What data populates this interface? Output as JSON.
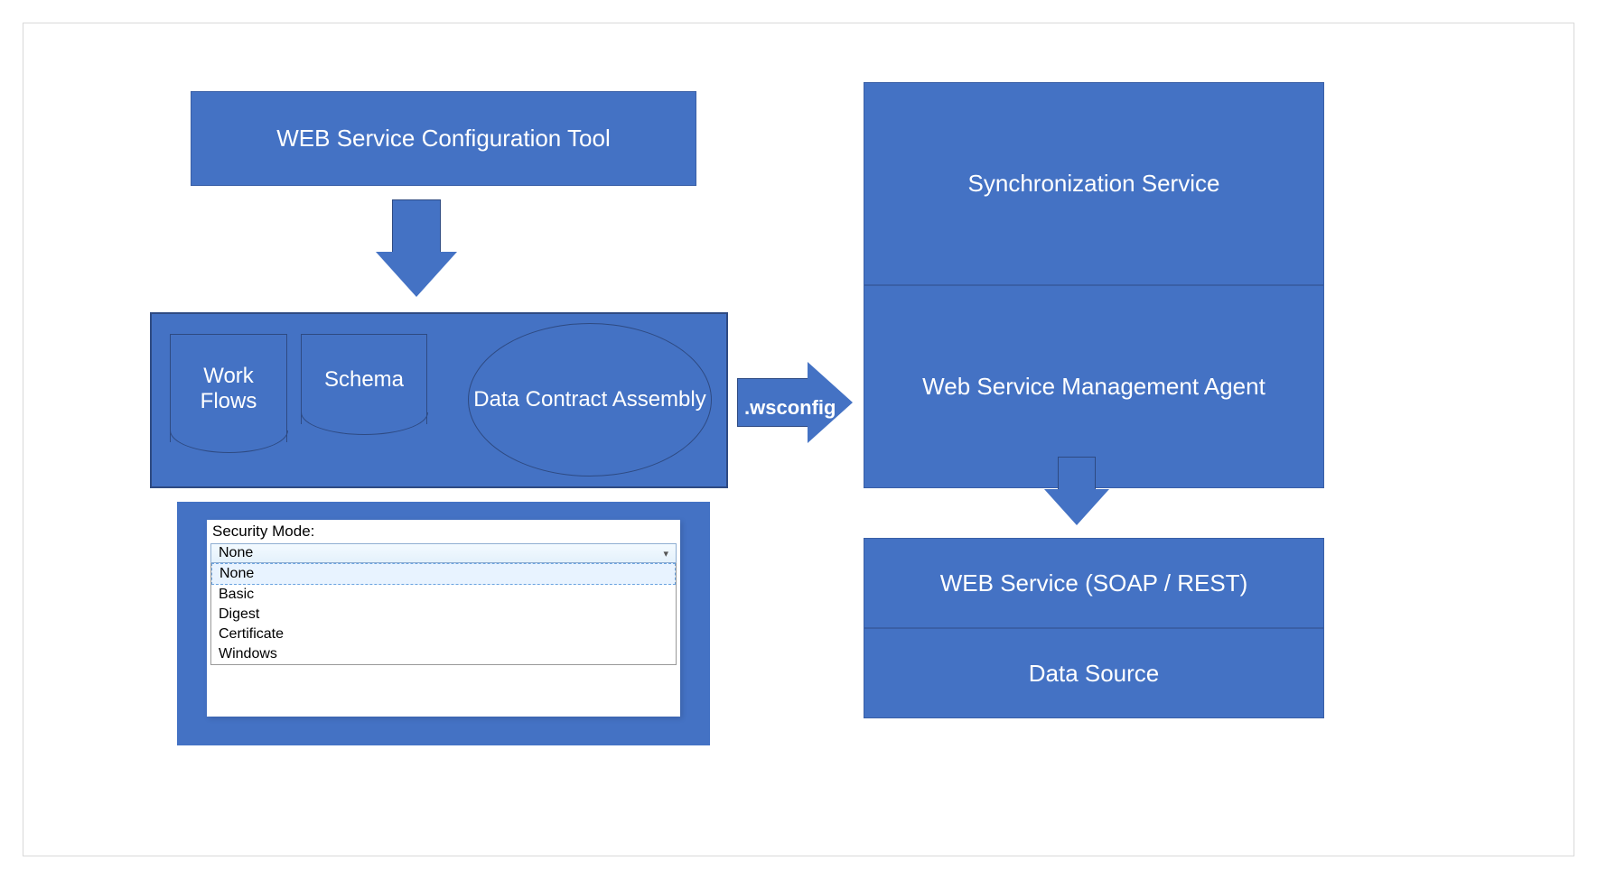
{
  "colors": {
    "primary": "#4472c4",
    "primary_border": "#2e4a82"
  },
  "boxes": {
    "config_tool": "WEB Service Configuration Tool",
    "sync_service": "Synchronization Service",
    "mgmt_agent": "Web Service Management Agent",
    "web_service": "WEB Service (SOAP / REST)",
    "data_source": "Data Source"
  },
  "artifacts": {
    "workflows": "Work Flows",
    "schema": "Schema",
    "data_contract": "Data Contract Assembly"
  },
  "arrow_label": ".wsconfig",
  "security": {
    "label": "Security Mode:",
    "selected": "None",
    "options": [
      "None",
      "Basic",
      "Digest",
      "Certificate",
      "Windows"
    ]
  }
}
